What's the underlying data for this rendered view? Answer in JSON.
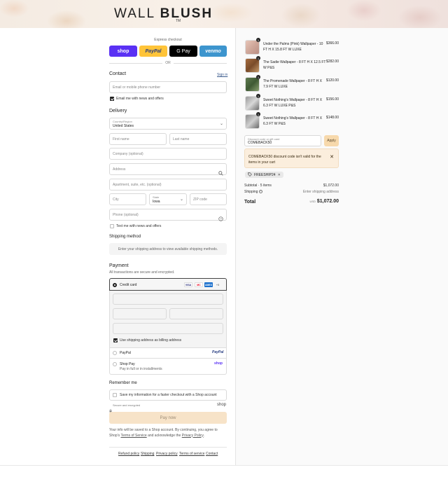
{
  "brand": {
    "name_light": "WALL",
    "name_bold": "BLUSH",
    "trademark": "TM"
  },
  "express": {
    "title": "Express checkout",
    "shop_label": "shop",
    "paypal_label": "PayPal",
    "gpay_label": "G Pay",
    "venmo_label": "venmo",
    "or_label": "OR"
  },
  "contact": {
    "heading": "Contact",
    "signin_label": "Sign in",
    "email_placeholder": "Email or mobile phone number",
    "news_label": "Email me with news and offers",
    "news_checked": true
  },
  "delivery": {
    "heading": "Delivery",
    "country_label": "Country/Region",
    "country_value": "United States",
    "first_name_ph": "First name",
    "last_name_ph": "Last name",
    "company_ph": "Company (optional)",
    "address_ph": "Address",
    "apartment_ph": "Apartment, suite, etc. (optional)",
    "city_ph": "City",
    "state_label": "State",
    "state_value": "Iowa",
    "zip_ph": "ZIP code",
    "phone_ph": "Phone (optional)",
    "text_label": "Text me with news and offers"
  },
  "shipping": {
    "heading": "Shipping method",
    "info": "Enter your shipping address to view available shipping methods."
  },
  "payment": {
    "heading": "Payment",
    "subtitle": "All transactions are secure and encrypted.",
    "credit_card_label": "Credit card",
    "card_brands": [
      "VISA",
      "MC",
      "AMEX",
      "+5"
    ],
    "billing_label": "Use shipping address as billing address",
    "paypal_label": "PayPal",
    "paypal_logo": "PayPal",
    "shoppay_label": "Shop Pay",
    "shoppay_sub": "Pay in full or in installments",
    "shoppay_logo": "shop"
  },
  "remember": {
    "heading": "Remember me",
    "save_label": "Save my information for a faster checkout with a Shop account",
    "secure_label": "Secure and encrypted",
    "shop_logo": "shop"
  },
  "pay_now_label": "Pay now",
  "terms": {
    "text_1": "Your info will be saved to a Shop account. By continuing, you agree to Shop's",
    "terms_link": "Terms of Service",
    "text_2": "and acknowledge the",
    "privacy_link": "Privacy Policy",
    "text_3": "."
  },
  "footer_links": [
    "Refund policy",
    "Shipping",
    "Privacy policy",
    "Terms of service",
    "Contact"
  ],
  "cart": {
    "items": [
      {
        "name": "Under the Palms (Pink) Wallpaper - 10 FT H X 15.8 FT W LUXE",
        "price": "$366.00",
        "qty": "1"
      },
      {
        "name": "The Sadie Wallpaper - 8 FT H X 12.5 FT W P&S",
        "price": "$282.00",
        "qty": "1"
      },
      {
        "name": "The Promenade Wallpaper - 8 FT H X 7.9 FT W LUXE",
        "price": "$120.00",
        "qty": "1"
      },
      {
        "name": "Sweet Nothing's Wallpaper - 8 FT H X 6.3 FT W LUXE P&S",
        "price": "$156.00",
        "qty": "1"
      },
      {
        "name": "Sweet Nothing's Wallpaper - 8 FT H X 6.3 FT W P&S",
        "price": "$148.00",
        "qty": "1"
      }
    ],
    "discount_label": "Discount code or gift card",
    "discount_value": "COMEBACK50",
    "apply_label": "Apply",
    "error_text": "COMEBACK50 discount code isn't valid for the items in your cart",
    "applied_code": "FREESHIP24",
    "subtotal_label": "Subtotal · 5 items",
    "subtotal_value": "$1,072.00",
    "shipping_label": "Shipping",
    "shipping_value": "Enter shipping address",
    "total_label": "Total",
    "currency": "USD",
    "total_value": "$1,072.00"
  }
}
